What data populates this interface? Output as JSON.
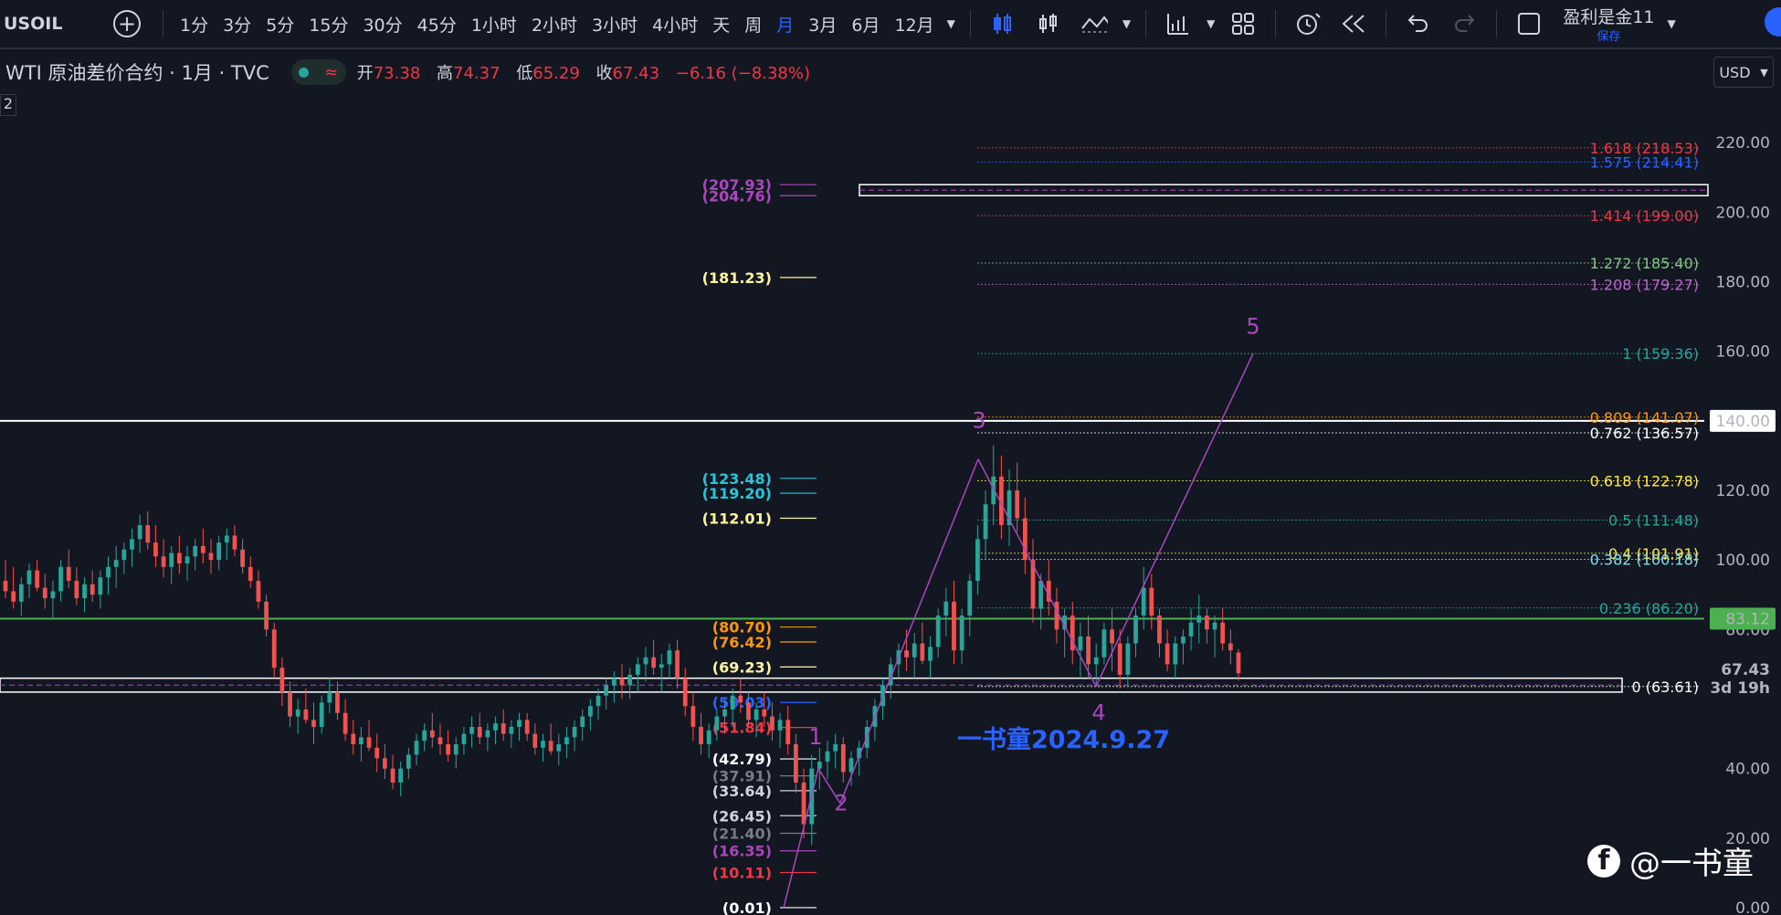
{
  "toolbar": {
    "symbol": "USOIL",
    "add_label": "+",
    "intervals": [
      {
        "label": "1分",
        "active": false
      },
      {
        "label": "3分",
        "active": false
      },
      {
        "label": "5分",
        "active": false
      },
      {
        "label": "15分",
        "active": false
      },
      {
        "label": "30分",
        "active": false
      },
      {
        "label": "45分",
        "active": false
      },
      {
        "label": "1小时",
        "active": false
      },
      {
        "label": "2小时",
        "active": false
      },
      {
        "label": "3小时",
        "active": false
      },
      {
        "label": "4小时",
        "active": false
      },
      {
        "label": "天",
        "active": false
      },
      {
        "label": "周",
        "active": false
      },
      {
        "label": "月",
        "active": true
      },
      {
        "label": "3月",
        "active": false
      },
      {
        "label": "6月",
        "active": false
      },
      {
        "label": "12月",
        "active": false
      }
    ],
    "user_name": "盈利是金11",
    "save_label": "保存",
    "icons": [
      "chevron-down-icon",
      "candles-icon",
      "bars-icon",
      "indicators-icon",
      "chart-style-icon",
      "layout-grid-icon",
      "alert-icon",
      "replay-icon",
      "undo-icon",
      "redo-icon",
      "fullscreen-icon"
    ]
  },
  "legend": {
    "title": "WTI 原油差价合约 · 1月 · TVC",
    "open_label": "开",
    "open": "73.38",
    "high_label": "高",
    "high": "74.37",
    "low_label": "低",
    "low": "65.29",
    "close_label": "收",
    "close": "67.43",
    "change": "−6.16 (−8.38%)",
    "side_number": "2"
  },
  "currency": "USD",
  "colors": {
    "background": "#131722",
    "up": "#26a69a",
    "down": "#ef5350",
    "accent": "#2962ff",
    "wave": "#ab47bc",
    "green_line": "#4caf50"
  },
  "chart_data": {
    "type": "candlestick",
    "y_axis": {
      "min": 0,
      "max": 230,
      "ticks": [
        {
          "value": 0,
          "label": "0.00"
        },
        {
          "value": 20,
          "label": "20.00"
        },
        {
          "value": 40,
          "label": "40.00"
        },
        {
          "value": 80,
          "label": "80.00"
        },
        {
          "value": 100,
          "label": "100.00"
        },
        {
          "value": 120,
          "label": "120.00"
        },
        {
          "value": 140,
          "label": "140.00"
        },
        {
          "value": 160,
          "label": "160.00"
        },
        {
          "value": 180,
          "label": "180.00"
        },
        {
          "value": 200,
          "label": "200.00"
        },
        {
          "value": 220,
          "label": "220.00"
        }
      ]
    },
    "price_labels": [
      {
        "value": 140,
        "label": "140.00",
        "style": "white"
      },
      {
        "value": 83.12,
        "label": "83.12",
        "style": "green"
      },
      {
        "value": 67.43,
        "label": "67.43",
        "style": "plain"
      }
    ],
    "countdown": "3d 19h",
    "horizontal_lines": [
      {
        "value": 140,
        "color": "#ffffff"
      },
      {
        "value": 83.12,
        "color": "#4caf50"
      }
    ],
    "zones": [
      {
        "top": 207.93,
        "bottom": 204.76
      },
      {
        "top": 66.0,
        "bottom": 62.0
      }
    ],
    "fib_extension": [
      {
        "ratio": "1.618",
        "value": "218.53",
        "color": "#f23645"
      },
      {
        "ratio": "1.575",
        "value": "214.41",
        "color": "#2962ff"
      },
      {
        "ratio": "1.414",
        "value": "199.00",
        "color": "#f23645"
      },
      {
        "ratio": "1.272",
        "value": "185.40",
        "color": "#81c784"
      },
      {
        "ratio": "1.208",
        "value": "179.27",
        "color": "#ba68c8"
      },
      {
        "ratio": "1",
        "value": "159.36",
        "color": "#26a69a"
      },
      {
        "ratio": "0.809",
        "value": "141.07",
        "color": "#ff9800"
      },
      {
        "ratio": "0.762",
        "value": "136.57",
        "color": "#ffffff"
      },
      {
        "ratio": "0.618",
        "value": "122.78",
        "color": "#ffeb3b"
      },
      {
        "ratio": "0.5",
        "value": "111.48",
        "color": "#26a69a"
      },
      {
        "ratio": "0.4",
        "value": "101.91",
        "color": "#ffeb3b"
      },
      {
        "ratio": "0.382",
        "value": "100.18",
        "color": "#80deea"
      },
      {
        "ratio": "0.236",
        "value": "86.20",
        "color": "#26a69a"
      },
      {
        "ratio": "0",
        "value": "63.61",
        "color": "#ffffff"
      }
    ],
    "left_levels": [
      {
        "value": "207.93",
        "color": "#ab47bc"
      },
      {
        "value": "204.76",
        "color": "#ab47bc"
      },
      {
        "value": "181.23",
        "color": "#fff59d"
      },
      {
        "value": "123.48",
        "color": "#26c6da"
      },
      {
        "value": "119.20",
        "color": "#26c6da"
      },
      {
        "value": "112.01",
        "color": "#fff59d"
      },
      {
        "value": "80.70",
        "color": "#ff9800"
      },
      {
        "value": "76.42",
        "color": "#ff9800"
      },
      {
        "value": "69.23",
        "color": "#fff59d"
      },
      {
        "value": "59.03",
        "color": "#2962ff"
      },
      {
        "value": "51.84",
        "color": "#f23645"
      },
      {
        "value": "42.79",
        "color": "#ffffff"
      },
      {
        "value": "37.91",
        "color": "#787b86"
      },
      {
        "value": "33.64",
        "color": "#d1d4dc"
      },
      {
        "value": "26.45",
        "color": "#d1d4dc"
      },
      {
        "value": "21.40",
        "color": "#787b86"
      },
      {
        "value": "16.35",
        "color": "#ab47bc"
      },
      {
        "value": "10.11",
        "color": "#f23645"
      },
      {
        "value": "0.01",
        "color": "#ffffff"
      }
    ],
    "wave_labels": [
      {
        "label": "1",
        "value": 47
      },
      {
        "label": "2",
        "value": 28
      },
      {
        "label": "3",
        "value": 138
      },
      {
        "label": "4",
        "value": 54
      },
      {
        "label": "5",
        "value": 165
      }
    ],
    "candles": [
      [
        94,
        100,
        89,
        91
      ],
      [
        91,
        98,
        86,
        88
      ],
      [
        88,
        95,
        84,
        93
      ],
      [
        93,
        99,
        89,
        97
      ],
      [
        97,
        100,
        91,
        92
      ],
      [
        92,
        96,
        86,
        89
      ],
      [
        89,
        94,
        83,
        91
      ],
      [
        91,
        100,
        88,
        98
      ],
      [
        98,
        103,
        92,
        94
      ],
      [
        94,
        98,
        87,
        89
      ],
      [
        89,
        95,
        85,
        93
      ],
      [
        93,
        97,
        88,
        90
      ],
      [
        90,
        97,
        86,
        95
      ],
      [
        95,
        101,
        90,
        98
      ],
      [
        98,
        104,
        92,
        100
      ],
      [
        100,
        105,
        96,
        103
      ],
      [
        103,
        109,
        98,
        106
      ],
      [
        106,
        113,
        102,
        110
      ],
      [
        110,
        114,
        103,
        105
      ],
      [
        105,
        110,
        98,
        101
      ],
      [
        101,
        106,
        95,
        98
      ],
      [
        98,
        104,
        93,
        102
      ],
      [
        102,
        107,
        96,
        99
      ],
      [
        99,
        104,
        94,
        101
      ],
      [
        101,
        106,
        97,
        104
      ],
      [
        104,
        109,
        99,
        102
      ],
      [
        102,
        106,
        96,
        100
      ],
      [
        100,
        107,
        97,
        105
      ],
      [
        105,
        109,
        100,
        107
      ],
      [
        107,
        110,
        101,
        103
      ],
      [
        103,
        106,
        96,
        98
      ],
      [
        98,
        101,
        92,
        94
      ],
      [
        94,
        97,
        86,
        88
      ],
      [
        88,
        90,
        78,
        80
      ],
      [
        80,
        82,
        66,
        69
      ],
      [
        69,
        72,
        58,
        62
      ],
      [
        62,
        65,
        52,
        55
      ],
      [
        55,
        60,
        50,
        57
      ],
      [
        57,
        63,
        53,
        54
      ],
      [
        54,
        59,
        47,
        52
      ],
      [
        52,
        61,
        50,
        59
      ],
      [
        59,
        66,
        56,
        62
      ],
      [
        62,
        65,
        54,
        56
      ],
      [
        56,
        60,
        48,
        50
      ],
      [
        50,
        54,
        44,
        47
      ],
      [
        47,
        52,
        42,
        49
      ],
      [
        49,
        54,
        45,
        46
      ],
      [
        46,
        50,
        39,
        43
      ],
      [
        43,
        47,
        37,
        40
      ],
      [
        40,
        44,
        34,
        36
      ],
      [
        36,
        42,
        32,
        40
      ],
      [
        40,
        46,
        37,
        44
      ],
      [
        44,
        50,
        41,
        48
      ],
      [
        48,
        53,
        45,
        51
      ],
      [
        51,
        56,
        46,
        49
      ],
      [
        49,
        53,
        44,
        47
      ],
      [
        47,
        51,
        42,
        44
      ],
      [
        44,
        49,
        40,
        47
      ],
      [
        47,
        52,
        44,
        50
      ],
      [
        50,
        55,
        46,
        52
      ],
      [
        52,
        56,
        47,
        49
      ],
      [
        49,
        53,
        45,
        51
      ],
      [
        51,
        55,
        47,
        53
      ],
      [
        53,
        57,
        48,
        50
      ],
      [
        50,
        54,
        46,
        52
      ],
      [
        52,
        56,
        48,
        54
      ],
      [
        54,
        56,
        48,
        50
      ],
      [
        50,
        53,
        44,
        46
      ],
      [
        46,
        50,
        42,
        48
      ],
      [
        48,
        53,
        44,
        45
      ],
      [
        45,
        50,
        41,
        47
      ],
      [
        47,
        52,
        43,
        49
      ],
      [
        49,
        54,
        45,
        52
      ],
      [
        52,
        57,
        48,
        55
      ],
      [
        55,
        60,
        51,
        58
      ],
      [
        58,
        63,
        54,
        61
      ],
      [
        61,
        66,
        57,
        64
      ],
      [
        64,
        68,
        59,
        66
      ],
      [
        66,
        70,
        60,
        64
      ],
      [
        64,
        69,
        60,
        67
      ],
      [
        67,
        72,
        62,
        70
      ],
      [
        70,
        75,
        65,
        72
      ],
      [
        72,
        77,
        67,
        69
      ],
      [
        69,
        73,
        62,
        70
      ],
      [
        70,
        76,
        66,
        74
      ],
      [
        74,
        77,
        63,
        66
      ],
      [
        66,
        69,
        55,
        58
      ],
      [
        58,
        62,
        48,
        52
      ],
      [
        52,
        56,
        44,
        47
      ],
      [
        47,
        53,
        43,
        51
      ],
      [
        51,
        57,
        48,
        55
      ],
      [
        55,
        60,
        50,
        57
      ],
      [
        57,
        63,
        52,
        61
      ],
      [
        61,
        66,
        56,
        59
      ],
      [
        59,
        62,
        52,
        54
      ],
      [
        54,
        59,
        49,
        57
      ],
      [
        57,
        62,
        52,
        55
      ],
      [
        55,
        59,
        48,
        51
      ],
      [
        51,
        56,
        46,
        54
      ],
      [
        54,
        58,
        44,
        47
      ],
      [
        47,
        50,
        33,
        36
      ],
      [
        36,
        40,
        20,
        24
      ],
      [
        24,
        44,
        18,
        40
      ],
      [
        40,
        46,
        34,
        42
      ],
      [
        42,
        48,
        37,
        45
      ],
      [
        45,
        50,
        40,
        47
      ],
      [
        47,
        49,
        36,
        39
      ],
      [
        39,
        45,
        35,
        43
      ],
      [
        43,
        48,
        38,
        46
      ],
      [
        46,
        54,
        43,
        52
      ],
      [
        52,
        60,
        48,
        58
      ],
      [
        58,
        66,
        54,
        64
      ],
      [
        64,
        72,
        60,
        70
      ],
      [
        70,
        76,
        66,
        74
      ],
      [
        74,
        80,
        68,
        72
      ],
      [
        72,
        79,
        66,
        76
      ],
      [
        76,
        82,
        70,
        71
      ],
      [
        71,
        78,
        66,
        75
      ],
      [
        75,
        86,
        72,
        84
      ],
      [
        84,
        92,
        78,
        88
      ],
      [
        88,
        94,
        70,
        74
      ],
      [
        74,
        86,
        70,
        84
      ],
      [
        84,
        96,
        78,
        94
      ],
      [
        94,
        110,
        90,
        106
      ],
      [
        106,
        120,
        100,
        116
      ],
      [
        116,
        133,
        110,
        124
      ],
      [
        124,
        130,
        106,
        110
      ],
      [
        110,
        126,
        104,
        120
      ],
      [
        120,
        128,
        108,
        112
      ],
      [
        112,
        118,
        96,
        100
      ],
      [
        100,
        106,
        82,
        86
      ],
      [
        86,
        96,
        80,
        94
      ],
      [
        94,
        100,
        84,
        88
      ],
      [
        88,
        92,
        76,
        80
      ],
      [
        80,
        86,
        72,
        84
      ],
      [
        84,
        88,
        70,
        74
      ],
      [
        74,
        82,
        66,
        78
      ],
      [
        78,
        84,
        66,
        70
      ],
      [
        70,
        76,
        64,
        72
      ],
      [
        72,
        82,
        70,
        80
      ],
      [
        80,
        86,
        68,
        76
      ],
      [
        76,
        80,
        63,
        67
      ],
      [
        67,
        78,
        64,
        76
      ],
      [
        76,
        86,
        72,
        84
      ],
      [
        84,
        98,
        80,
        92
      ],
      [
        92,
        96,
        80,
        84
      ],
      [
        84,
        86,
        72,
        76
      ],
      [
        76,
        80,
        68,
        70
      ],
      [
        70,
        78,
        66,
        76
      ],
      [
        76,
        80,
        70,
        78
      ],
      [
        78,
        86,
        74,
        82
      ],
      [
        82,
        90,
        76,
        84
      ],
      [
        84,
        86,
        76,
        80
      ],
      [
        80,
        84,
        72,
        82
      ],
      [
        82,
        86,
        74,
        76
      ],
      [
        76,
        80,
        70,
        74
      ],
      [
        73.38,
        74.37,
        65.29,
        67.43
      ]
    ]
  },
  "annotation": "一书童2024.9.27",
  "watermark": "@一书童"
}
